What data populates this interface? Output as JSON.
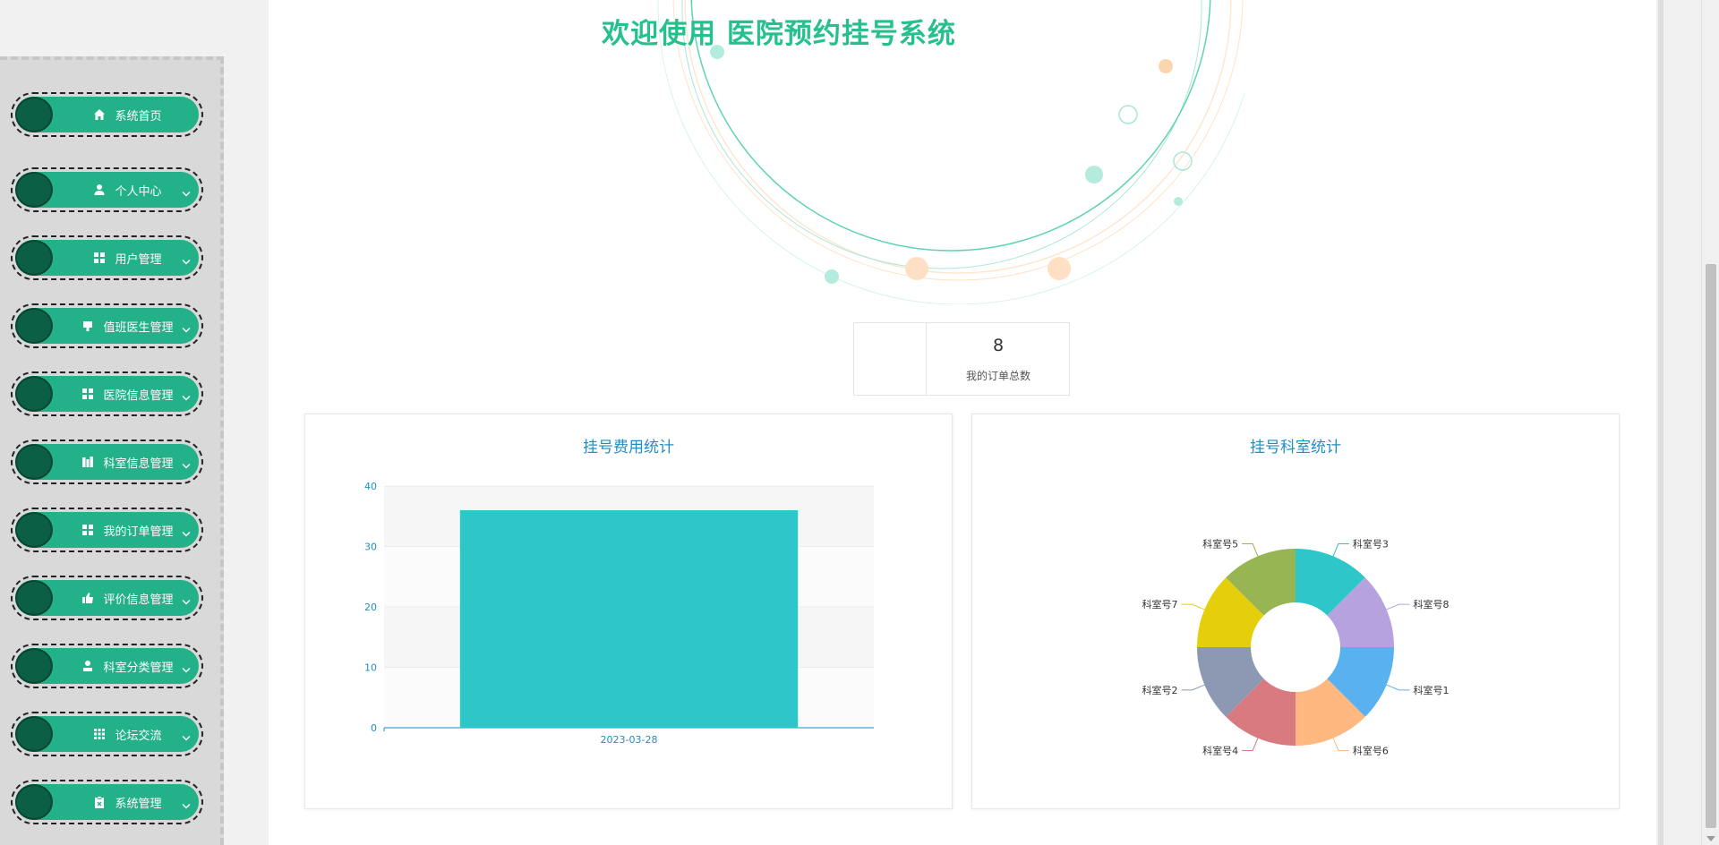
{
  "page": {
    "title": "欢迎使用 医院预约挂号系统"
  },
  "sidebar": {
    "items": [
      {
        "label": "系统首页",
        "icon": "home-icon",
        "has_submenu": false
      },
      {
        "label": "个人中心",
        "icon": "user-icon",
        "has_submenu": true
      },
      {
        "label": "用户管理",
        "icon": "grid-icon",
        "has_submenu": true
      },
      {
        "label": "值班医生管理",
        "icon": "clipboard-icon",
        "has_submenu": true
      },
      {
        "label": "医院信息管理",
        "icon": "grid-icon",
        "has_submenu": true
      },
      {
        "label": "科室信息管理",
        "icon": "building-icon",
        "has_submenu": true
      },
      {
        "label": "我的订单管理",
        "icon": "grid-icon",
        "has_submenu": true
      },
      {
        "label": "评价信息管理",
        "icon": "thumb-icon",
        "has_submenu": true
      },
      {
        "label": "科室分类管理",
        "icon": "person-badge-icon",
        "has_submenu": true
      },
      {
        "label": "论坛交流",
        "icon": "apps-icon",
        "has_submenu": true
      },
      {
        "label": "系统管理",
        "icon": "clipboard-x-icon",
        "has_submenu": true
      }
    ]
  },
  "stats": {
    "value": "8",
    "label": "我的订单总数"
  },
  "colors": {
    "accent": "#22b189",
    "title": "#26c08e",
    "chart_title": "#1f8fc3",
    "bar": "#2ec7c9"
  },
  "charts": {
    "bar_title": "挂号费用统计",
    "pie_title": "挂号科室统计"
  },
  "chart_data": [
    {
      "type": "bar",
      "title": "挂号费用统计",
      "categories": [
        "2023-03-28"
      ],
      "values": [
        36
      ],
      "ylim": [
        0,
        40
      ],
      "yticks": [
        0,
        10,
        20,
        30,
        40
      ],
      "grid": true
    },
    {
      "type": "pie",
      "title": "挂号科室统计",
      "donut": true,
      "slices": [
        {
          "label": "科室号3",
          "value": 1,
          "color": "#2ec7c9"
        },
        {
          "label": "科室号8",
          "value": 1,
          "color": "#b6a2de"
        },
        {
          "label": "科室号1",
          "value": 1,
          "color": "#5ab1ef"
        },
        {
          "label": "科室号6",
          "value": 1,
          "color": "#ffb980"
        },
        {
          "label": "科室号4",
          "value": 1,
          "color": "#d87a80"
        },
        {
          "label": "科室号2",
          "value": 1,
          "color": "#8d98b3"
        },
        {
          "label": "科室号7",
          "value": 1,
          "color": "#e5cf0d"
        },
        {
          "label": "科室号5",
          "value": 1,
          "color": "#97b552"
        }
      ]
    }
  ]
}
